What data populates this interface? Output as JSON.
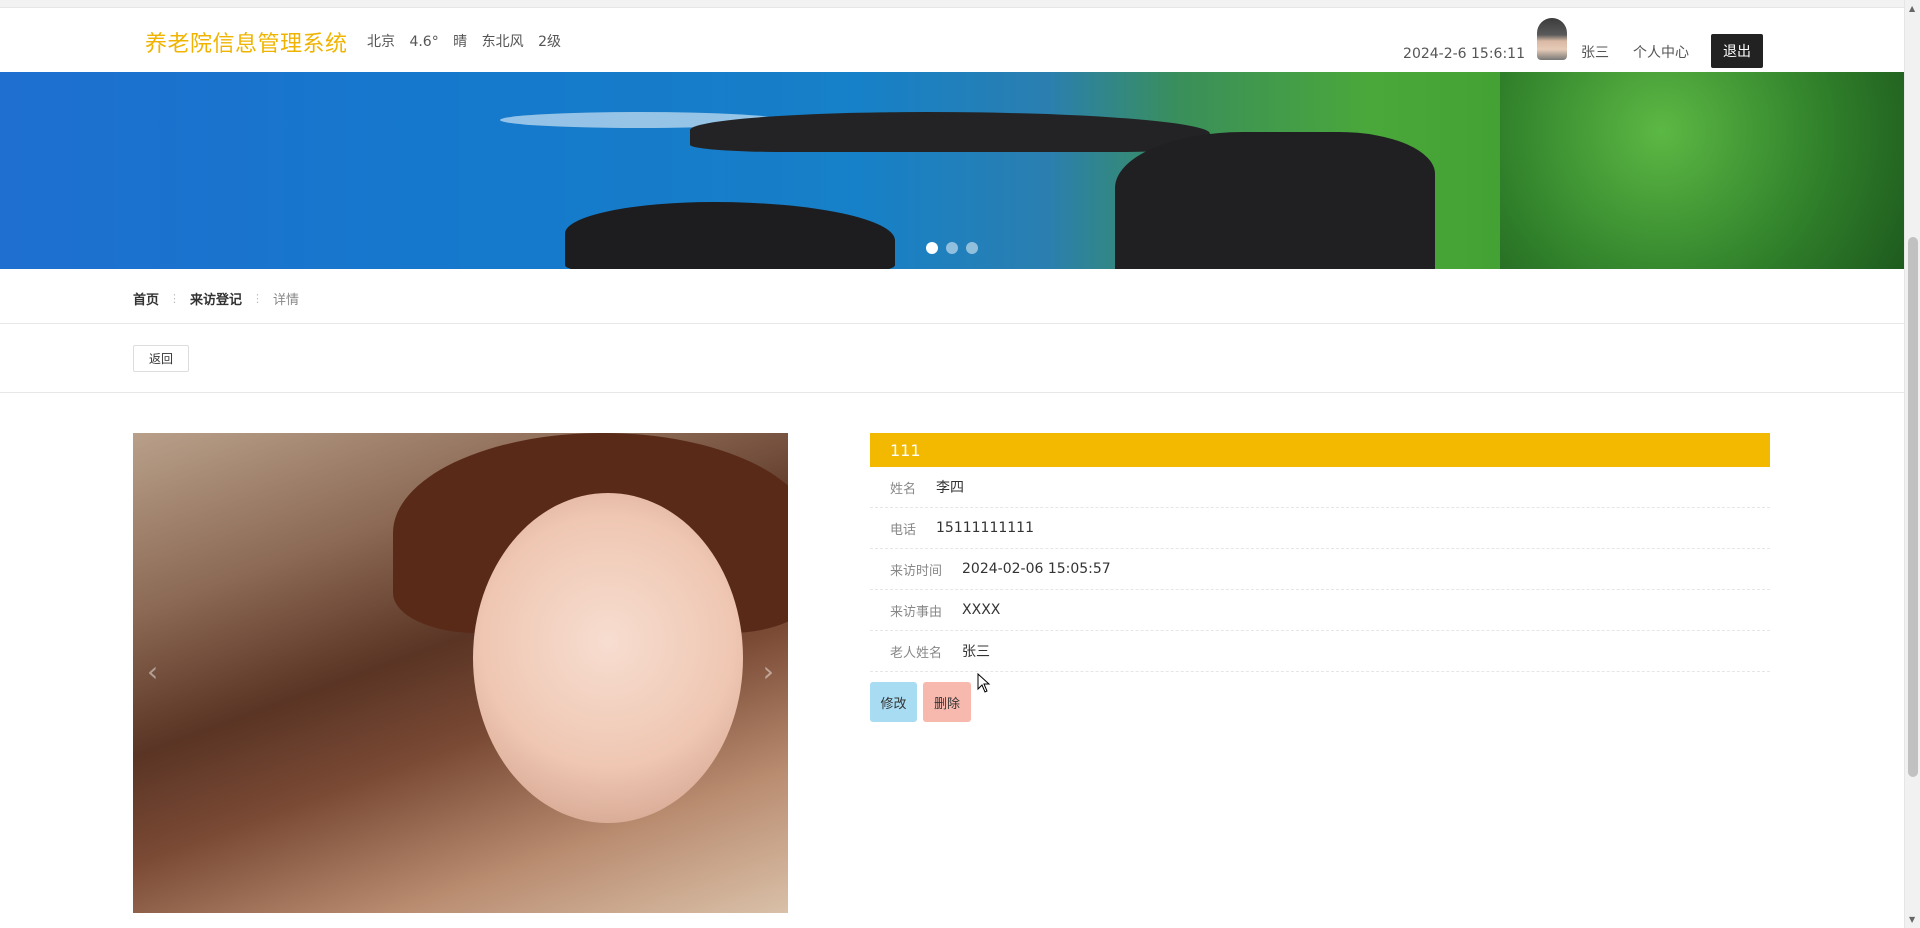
{
  "header": {
    "brand": "养老院信息管理系统",
    "weather": {
      "city": "北京",
      "temp": "4.6°",
      "condition": "晴",
      "wind": "东北风",
      "level": "2级"
    },
    "datetime": "2024-2-6 15:6:11",
    "username": "张三",
    "user_center": "个人中心",
    "logout": "退出"
  },
  "banner": {
    "slide_count": 3,
    "active_slide": 1
  },
  "breadcrumb": [
    "首页",
    "来访登记",
    "详情"
  ],
  "back_button": "返回",
  "detail": {
    "title": "111",
    "fields": [
      {
        "label": "姓名",
        "value": "李四"
      },
      {
        "label": "电话",
        "value": "15111111111"
      },
      {
        "label": "来访时间",
        "value": "2024-02-06 15:05:57"
      },
      {
        "label": "来访事由",
        "value": "XXXX"
      },
      {
        "label": "老人姓名",
        "value": "张三"
      }
    ],
    "edit_button": "修改",
    "delete_button": "删除"
  },
  "colors": {
    "brand": "#f0b400",
    "title_bar": "#f3b800",
    "edit_btn": "#a7dcf3",
    "delete_btn": "#f7b8ad"
  }
}
